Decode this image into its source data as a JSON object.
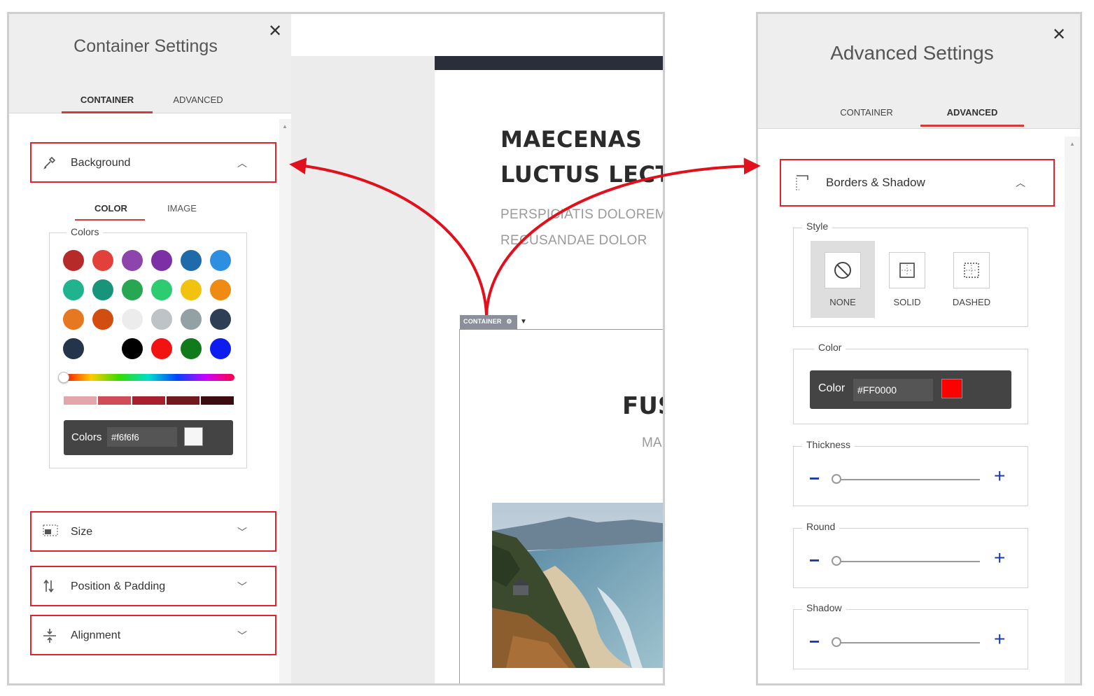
{
  "left_panel": {
    "title": "Container Settings",
    "tabs": [
      {
        "label": "CONTAINER"
      },
      {
        "label": "ADVANCED"
      }
    ],
    "sections": [
      {
        "label": "Background",
        "icon": "eyedropper-icon",
        "expanded": true
      },
      {
        "label": "Size",
        "icon": "size-icon",
        "expanded": false
      },
      {
        "label": "Position & Padding",
        "icon": "position-arrows-icon",
        "expanded": false
      },
      {
        "label": "Alignment",
        "icon": "alignment-icon",
        "expanded": false
      }
    ],
    "background": {
      "subtabs": [
        {
          "label": "COLOR"
        },
        {
          "label": "IMAGE"
        }
      ],
      "colors_legend": "Colors",
      "swatches": [
        "#b72a2a",
        "#e2413b",
        "#8e44ad",
        "#7d2fa5",
        "#1f6aa8",
        "#2e8ee0",
        "#1fb38e",
        "#17947a",
        "#28a753",
        "#2ecc71",
        "#f1c30f",
        "#ef8b12",
        "#e67822",
        "#d24e10",
        "#ececec",
        "#bdc3c7",
        "#93a0a4",
        "#2e3e54",
        "#24344b",
        "",
        "#000000",
        "#f21212",
        "#117a1b",
        "#0d1df0"
      ],
      "shades": [
        "#e3a7ab",
        "#d04d58",
        "#a8202b",
        "#701a20",
        "#3b0d10"
      ],
      "input_label": "Colors",
      "input_value": "#f6f6f6",
      "input_swatch": "#f6f6f6"
    }
  },
  "page_preview": {
    "heading_line1": "MAECENAS",
    "heading_line2": "LUCTUS LECT",
    "sub_line1": "PERSPICIATIS DOLOREMC",
    "sub_line2": "RECUSANDAE DOLOR",
    "container_badge": "CONTAINER",
    "inner_heading": "FUS",
    "inner_sub": "MA"
  },
  "right_panel": {
    "title": "Advanced Settings",
    "tabs": [
      {
        "label": "CONTAINER"
      },
      {
        "label": "ADVANCED"
      }
    ],
    "section": {
      "label": "Borders & Shadow",
      "icon": "border-icon"
    },
    "style_legend": "Style",
    "styles": [
      {
        "label": "NONE"
      },
      {
        "label": "SOLID"
      },
      {
        "label": "DASHED"
      }
    ],
    "selected_style": "NONE",
    "color_legend": "Color",
    "color_label": "Color",
    "color_value": "#FF0000",
    "color_swatch": "#FF0000",
    "sliders": [
      {
        "label": "Thickness",
        "value": 0
      },
      {
        "label": "Round",
        "value": 0
      },
      {
        "label": "Shadow",
        "value": 0
      }
    ]
  },
  "colors": {
    "accent": "#e0232e",
    "tab_underline": "#d33a3a",
    "stepper": "#1a3aa8"
  }
}
